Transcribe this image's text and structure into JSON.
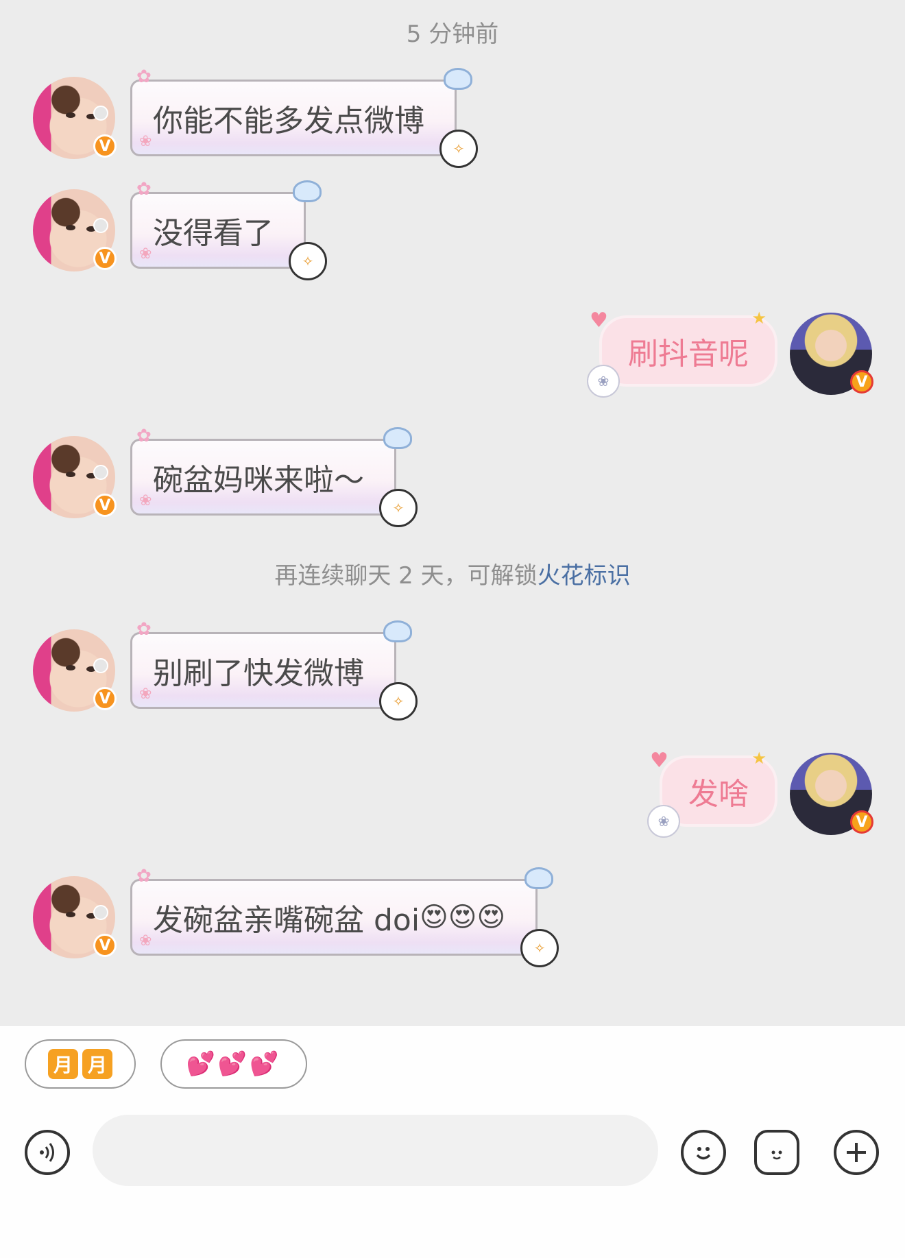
{
  "timestamp": "5 分钟前",
  "system_notice": {
    "prefix": "再连续聊天 2 天，可解锁",
    "link": "火花标识"
  },
  "badge_label": "V",
  "messages": [
    {
      "side": "left",
      "text": "你能不能多发点微博"
    },
    {
      "side": "left",
      "text": "没得看了"
    },
    {
      "side": "right",
      "text": "刷抖音呢"
    },
    {
      "side": "left",
      "text": "碗盆妈咪来啦～"
    },
    {
      "side": "left",
      "text": "别刷了快发微博"
    },
    {
      "side": "right",
      "text": "发啥"
    },
    {
      "side": "left",
      "text": "发碗盆亲嘴碗盆 doi",
      "emoji": "😍😍😍"
    }
  ],
  "quick_replies": {
    "moon": [
      "月",
      "月"
    ],
    "hearts": "💕💕💕"
  },
  "composer": {
    "placeholder": "",
    "voice_icon": "voice-icon",
    "emoji_icon": "smiley-icon",
    "sticker_icon": "sticker-star-icon",
    "plus_icon": "plus-icon"
  },
  "colors": {
    "link": "#4a6fa3",
    "right_bubble_text": "#ee7b93",
    "badge": "#f7931e"
  }
}
